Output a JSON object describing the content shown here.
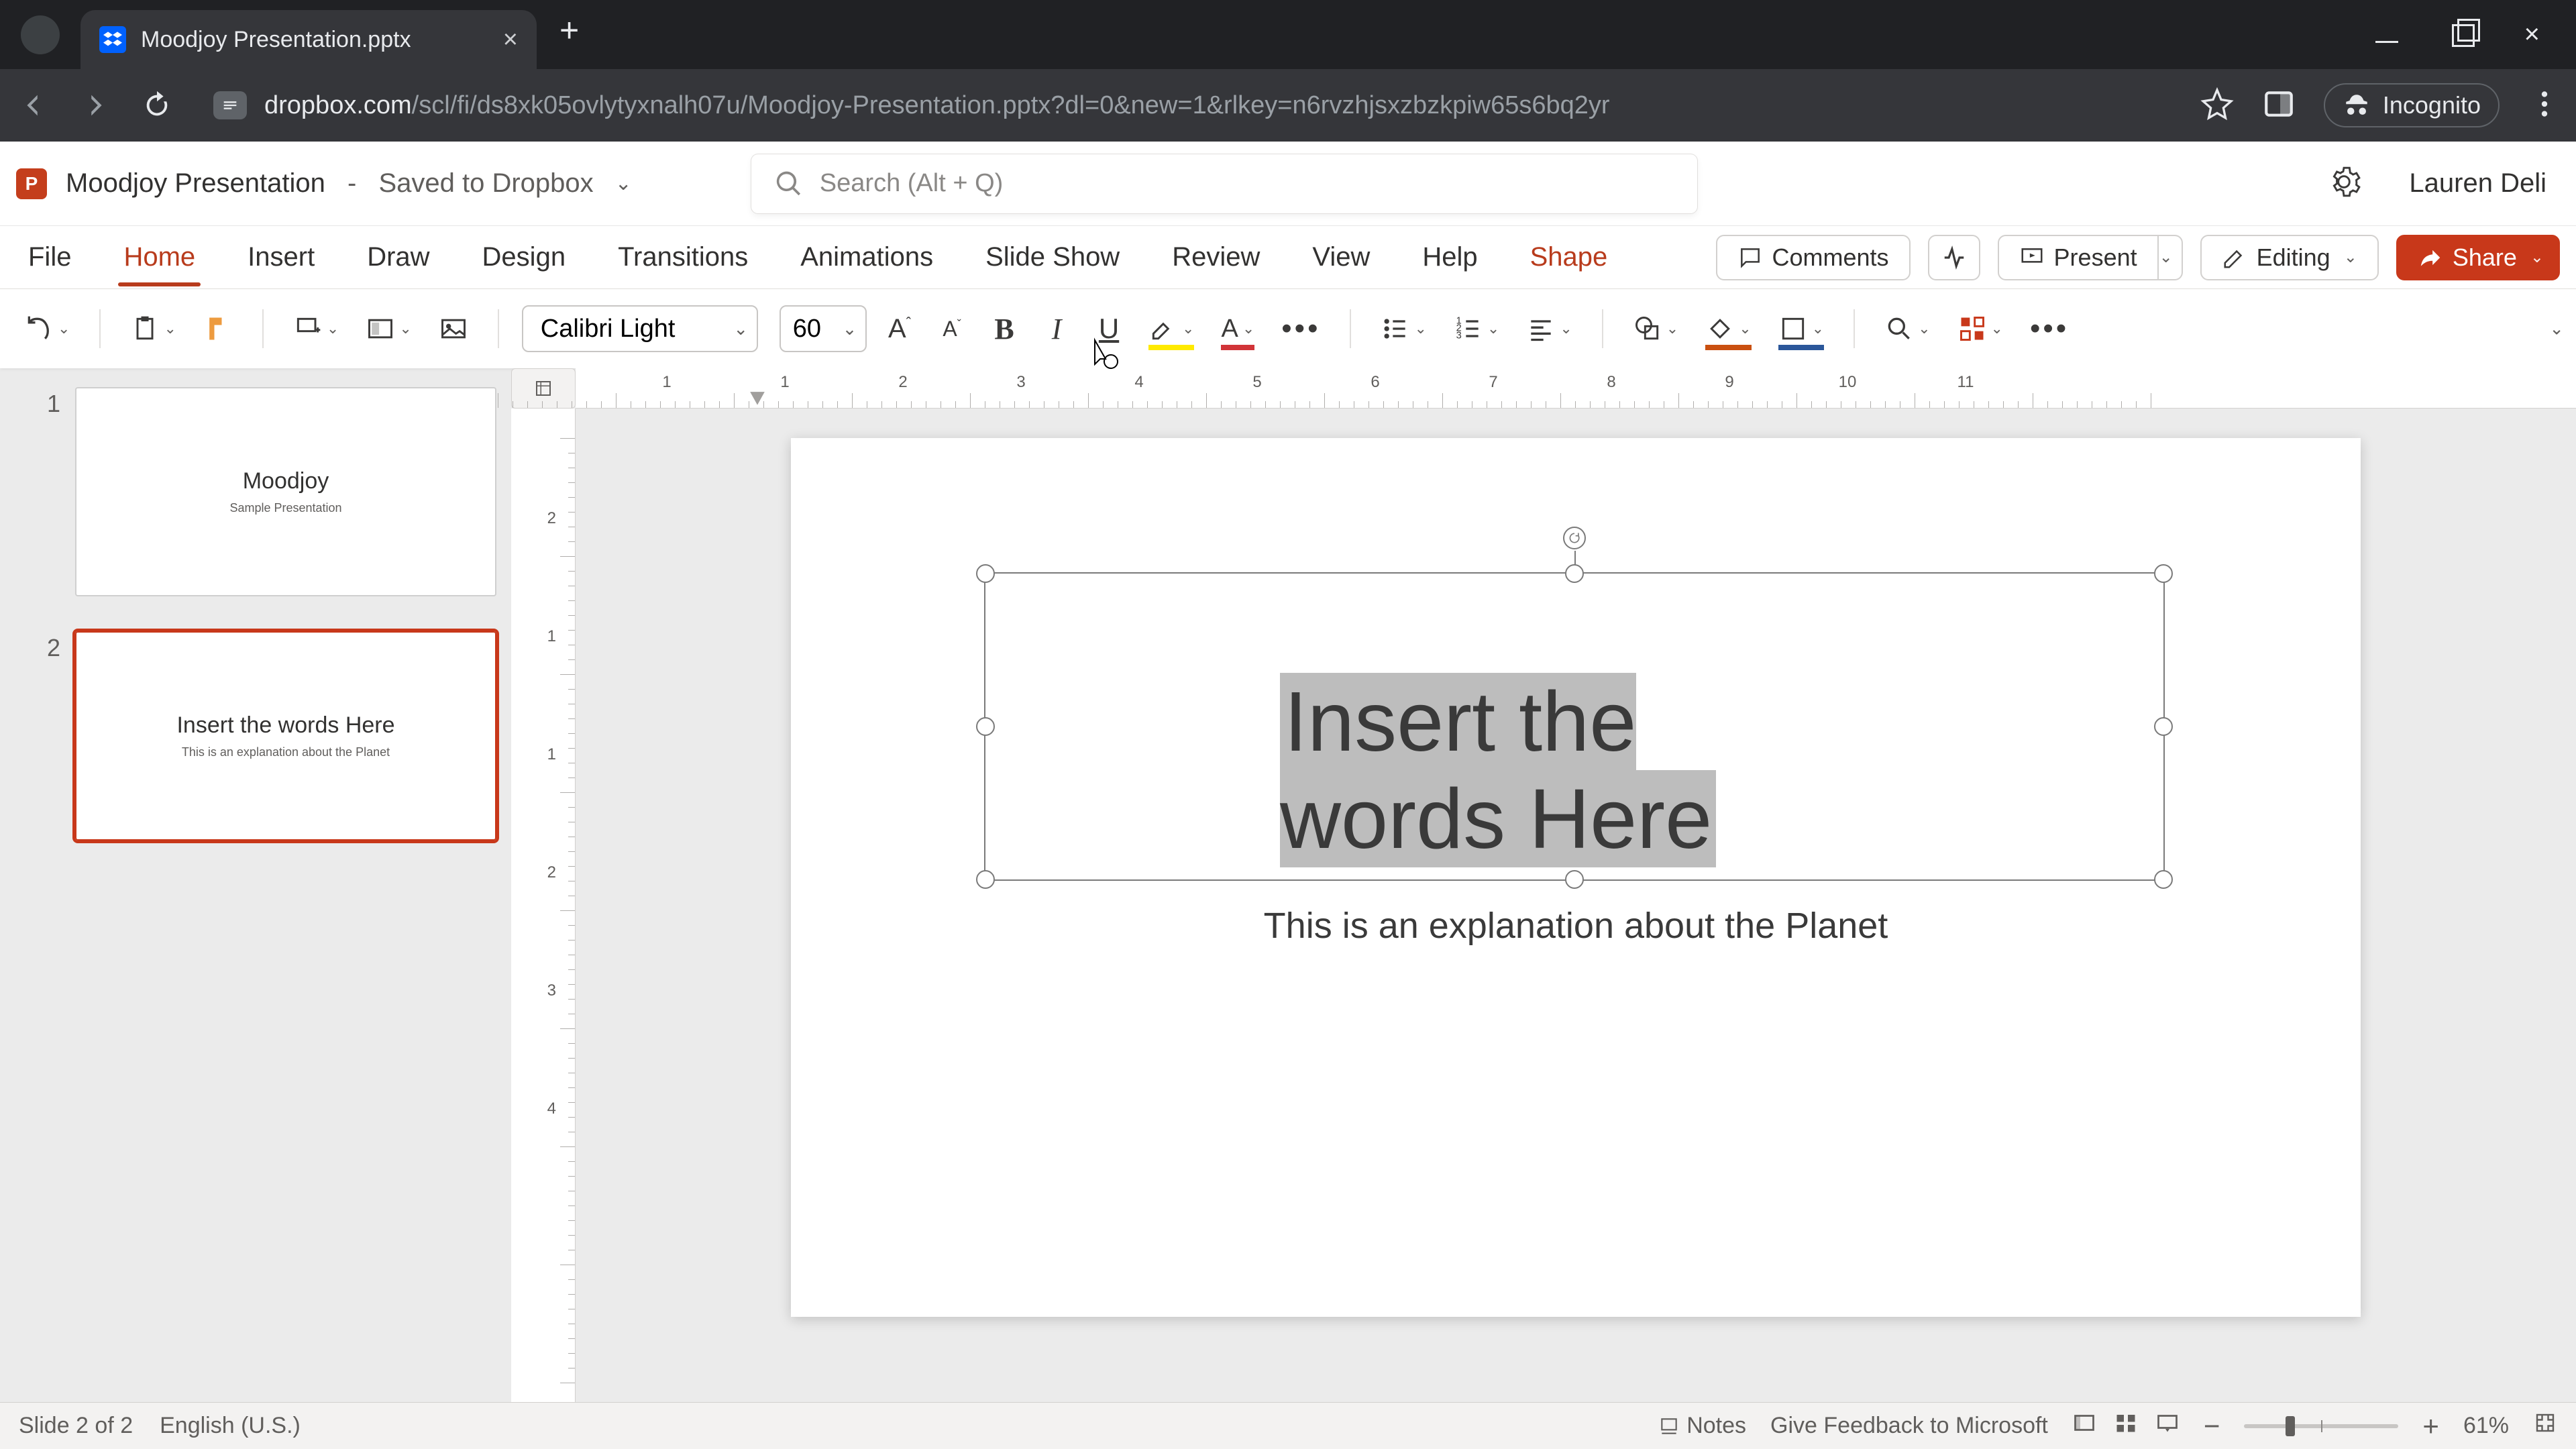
{
  "browser": {
    "tab_title": "Moodjoy Presentation.pptx",
    "url_host": "dropbox.com",
    "url_path": "/scl/fi/ds8xk05ovlytyxnalh07u/Moodjoy-Presentation.pptx?dl=0&new=1&rlkey=n6rvzhjsxzbzkpiw65s6bq2yr",
    "incognito_label": "Incognito"
  },
  "header": {
    "app_letter": "P",
    "doc_title": "Moodjoy Presentation",
    "saved_status": "Saved to Dropbox",
    "search_placeholder": "Search (Alt + Q)",
    "user_name": "Lauren Deli"
  },
  "ribbon": {
    "tabs": [
      "File",
      "Home",
      "Insert",
      "Draw",
      "Design",
      "Transitions",
      "Animations",
      "Slide Show",
      "Review",
      "View",
      "Help",
      "Shape"
    ],
    "active_index": 1,
    "context_index": 11,
    "comments_label": "Comments",
    "present_label": "Present",
    "editing_label": "Editing",
    "share_label": "Share"
  },
  "toolbar": {
    "font_name": "Calibri Light",
    "font_size": "60"
  },
  "thumbnails": [
    {
      "num": "1",
      "title": "Moodjoy",
      "sub": "Sample Presentation"
    },
    {
      "num": "2",
      "title": "Insert the words Here",
      "sub": "This is an explanation about the Planet"
    }
  ],
  "slide": {
    "title": "Insert the words Here",
    "subtitle": "This is an explanation about the Planet"
  },
  "ruler": {
    "h_labels": [
      "1",
      "1",
      "2",
      "3",
      "4",
      "5",
      "6",
      "7",
      "8",
      "9",
      "10",
      "11"
    ],
    "v_labels": [
      "2",
      "1",
      "1",
      "2",
      "3",
      "4"
    ]
  },
  "statusbar": {
    "slide_counter": "Slide 2 of 2",
    "language": "English (U.S.)",
    "notes_label": "Notes",
    "feedback_label": "Give Feedback to Microsoft",
    "zoom_percent": "61%",
    "minus": "−",
    "plus": "+"
  }
}
